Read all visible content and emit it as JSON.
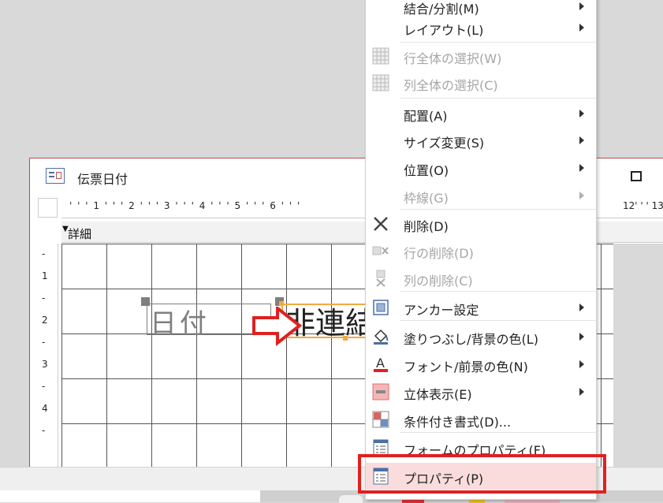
{
  "form_window": {
    "title": "伝票日付",
    "section": "詳細",
    "ruler_top": "' ' ' 1 ' ' ' 2 ' ' ' 3 ' ' ' 4 ' ' ' 5 ' ' ' 6 ' ' '",
    "ruler_top_right": "12' ' ' 13'",
    "ruler_left": [
      "-",
      "1",
      "-",
      "2",
      "-",
      "3",
      "-",
      "4",
      "-"
    ],
    "label_control": "日付",
    "text_control": "非連結"
  },
  "context_menu": {
    "items": [
      {
        "label": "結合/分割(M)",
        "enabled": true,
        "submenu": true,
        "icon": ""
      },
      {
        "label": "レイアウト(L)",
        "enabled": true,
        "submenu": true,
        "icon": ""
      },
      {
        "label": "行全体の選択(W)",
        "enabled": false,
        "submenu": false,
        "icon": "select-row-icon"
      },
      {
        "label": "列全体の選択(C)",
        "enabled": false,
        "submenu": false,
        "icon": "select-column-icon"
      },
      {
        "label": "配置(A)",
        "enabled": true,
        "submenu": true,
        "icon": ""
      },
      {
        "label": "サイズ変更(S)",
        "enabled": true,
        "submenu": true,
        "icon": ""
      },
      {
        "label": "位置(O)",
        "enabled": true,
        "submenu": true,
        "icon": ""
      },
      {
        "label": "枠線(G)",
        "enabled": false,
        "submenu": true,
        "icon": ""
      },
      {
        "label": "削除(D)",
        "enabled": true,
        "submenu": false,
        "icon": "delete-x-icon"
      },
      {
        "label": "行の削除(D)",
        "enabled": false,
        "submenu": false,
        "icon": "delete-row-icon"
      },
      {
        "label": "列の削除(C)",
        "enabled": false,
        "submenu": false,
        "icon": "delete-column-icon"
      },
      {
        "label": "アンカー設定",
        "enabled": true,
        "submenu": true,
        "icon": "anchor-icon"
      },
      {
        "label": "塗りつぶし/背景の色(L)",
        "enabled": true,
        "submenu": true,
        "icon": "paint-bucket-icon"
      },
      {
        "label": "フォント/前景の色(N)",
        "enabled": true,
        "submenu": true,
        "icon": "font-color-icon"
      },
      {
        "label": "立体表示(E)",
        "enabled": true,
        "submenu": true,
        "icon": "special-effect-icon"
      },
      {
        "label": "条件付き書式(D)...",
        "enabled": true,
        "submenu": false,
        "icon": "conditional-format-icon"
      },
      {
        "label": "フォームのプロパティ(F)",
        "enabled": true,
        "submenu": false,
        "icon": "form-properties-icon"
      },
      {
        "label": "プロパティ(P)",
        "enabled": true,
        "submenu": false,
        "icon": "properties-icon"
      }
    ]
  },
  "colors": {
    "highlight_border": "#e02020",
    "highlight_fill": "#fadcdc",
    "selection_orange": "#f4a93d"
  }
}
